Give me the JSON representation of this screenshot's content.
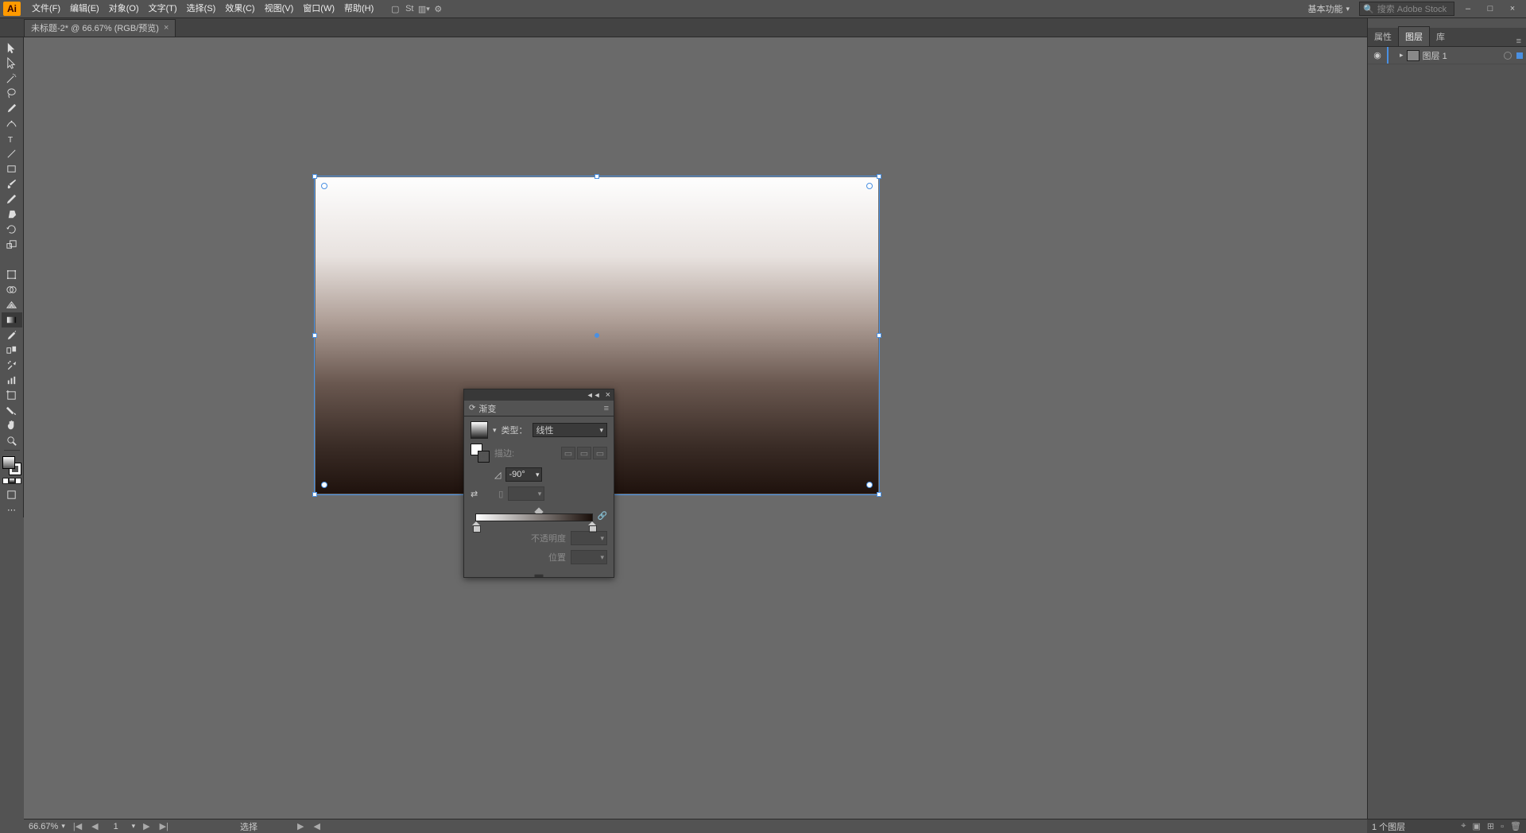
{
  "app_logo": "Ai",
  "menus": [
    "文件(F)",
    "编辑(E)",
    "对象(O)",
    "文字(T)",
    "选择(S)",
    "效果(C)",
    "视图(V)",
    "窗口(W)",
    "帮助(H)"
  ],
  "workspace": "基本功能",
  "search_placeholder": "搜索 Adobe Stock",
  "doc_tab": "未标题-2* @ 66.67% (RGB/预览)",
  "gradient_panel": {
    "title": "渐变",
    "type_label": "类型：",
    "type_value": "线性",
    "stroke_label": "描边:",
    "angle_value": "-90°",
    "opacity_label": "不透明度",
    "opacity_value": "",
    "position_label": "位置",
    "position_value": ""
  },
  "right_tabs": [
    "属性",
    "图层",
    "库"
  ],
  "layer": {
    "name": "图层 1"
  },
  "status": {
    "zoom": "66.67%",
    "artboard": "1",
    "tool": "选择"
  },
  "layer_count": "1 个图层",
  "icons": {
    "close": "×",
    "min": "–",
    "max": "□",
    "chev": "▾",
    "menu": "≡",
    "eye": "👁",
    "search": "🔍",
    "first": "|◀",
    "prev": "◀",
    "next": "▶",
    "last": "▶|",
    "play": "▶",
    "rev": "◀"
  }
}
